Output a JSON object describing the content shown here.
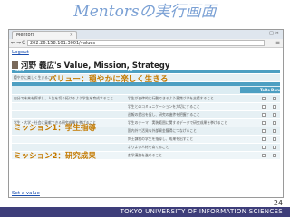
{
  "slide": {
    "title": "Mentorsの実行画面",
    "page_number": "24",
    "footer": "TOKYO UNIVERSITY OF INFORMATION SCIENCES"
  },
  "browser": {
    "tab_title": "Mentors",
    "tab_close": "×",
    "window_controls": "–□×",
    "url": "202.26.158.101:3001/values",
    "back": "←",
    "forward": "→",
    "reload": "C",
    "menu": "≡"
  },
  "page": {
    "logout": "Logout",
    "heading": "河野 義広's Value, Mission, Strategy",
    "value_header": "Value",
    "strategy_header": "Do",
    "vision_overlay": "バリュー：穏やかに楽しく生きる",
    "value_text": "穏やかに楽しく生きること",
    "btn_todo": "ToDo",
    "btn_done": "Done",
    "missions": [
      {
        "label": "ミッション1：学生指導"
      },
      {
        "label": "ミッション2：研究成果"
      }
    ],
    "rows": [
      {
        "mission": "",
        "strategy": "学生が自律的に行動できるよう意識づけを支援すること"
      },
      {
        "mission": "",
        "strategy": "学生とのコミュニケーションを大切にすること"
      },
      {
        "mission": "",
        "strategy": "週報の提出を促し、研究の進捗を把握すること"
      },
      {
        "mission": "学生・大学・社会に貢献できる研究成果を挙げること",
        "strategy": "学生のテーマ・実装範囲に関するデータで研究成果を挙げること"
      },
      {
        "mission": "",
        "strategy": "国内外で活発な外部資金獲得につなげること"
      },
      {
        "mission": "",
        "strategy": "博士課程の学生を指導し、成果を出すこと"
      },
      {
        "mission": "",
        "strategy": "よりよい人材を育てること"
      },
      {
        "mission": "",
        "strategy": "産学連携を進めること"
      }
    ],
    "first_row_left": "自分で未来を探求し、人生を切り拓けるよう学生を育成すること",
    "set_value": "Set a value"
  }
}
